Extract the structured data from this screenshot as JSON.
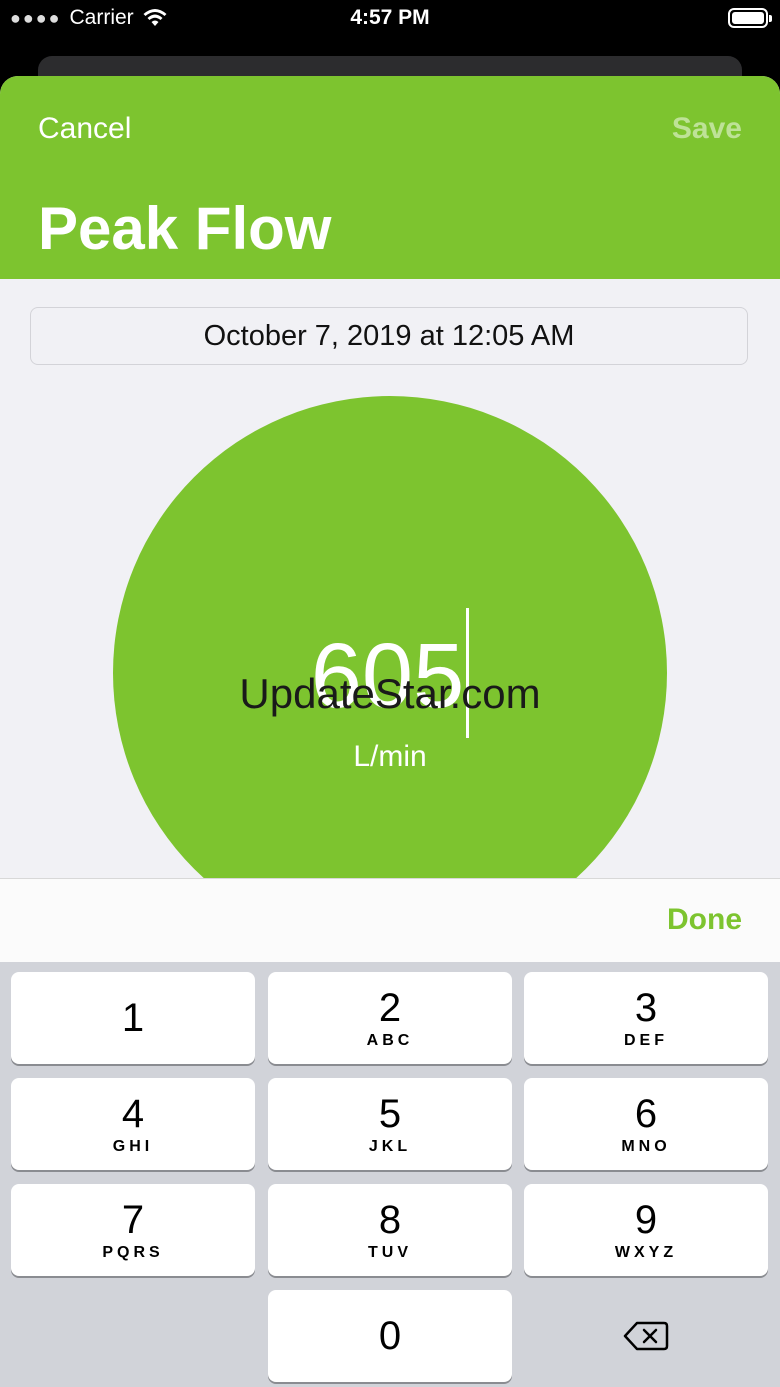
{
  "status": {
    "carrier": "Carrier",
    "time": "4:57 PM"
  },
  "nav": {
    "cancel_label": "Cancel",
    "save_label": "Save",
    "title": "Peak Flow"
  },
  "entry": {
    "date": "October 7, 2019 at 12:05 AM",
    "value": "605",
    "unit": "L/min"
  },
  "watermark": "UpdateStar.com",
  "accessory": {
    "done_label": "Done"
  },
  "keypad": {
    "keys": [
      {
        "num": "1",
        "letters": ""
      },
      {
        "num": "2",
        "letters": "ABC"
      },
      {
        "num": "3",
        "letters": "DEF"
      },
      {
        "num": "4",
        "letters": "GHI"
      },
      {
        "num": "5",
        "letters": "JKL"
      },
      {
        "num": "6",
        "letters": "MNO"
      },
      {
        "num": "7",
        "letters": "PQRS"
      },
      {
        "num": "8",
        "letters": "TUV"
      },
      {
        "num": "9",
        "letters": "WXYZ"
      },
      {
        "num": "0",
        "letters": ""
      }
    ],
    "delete_icon": "backspace-icon"
  },
  "colors": {
    "accent": "#7dc42f",
    "background": "#f1f1f5",
    "keyboard": "#d1d3d9"
  }
}
